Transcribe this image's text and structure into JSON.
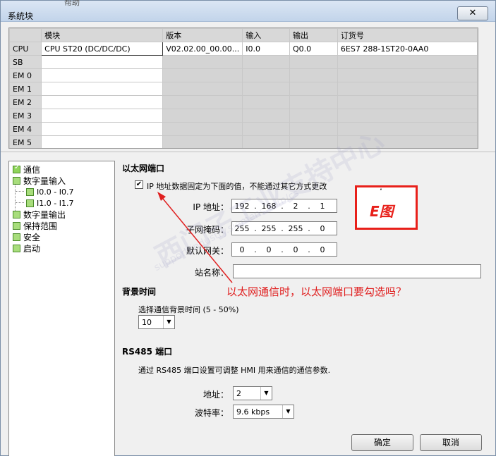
{
  "window": {
    "title": "系统块",
    "behind_menu_text": "帮助",
    "close_label": "✕"
  },
  "module_table": {
    "headers": [
      "",
      "模块",
      "版本",
      "输入",
      "输出",
      "订货号"
    ],
    "rows": [
      {
        "name": "CPU",
        "module": "CPU ST20 (DC/DC/DC)",
        "version": "V02.02.00_00.00...",
        "input": "I0.0",
        "output": "Q0.0",
        "order": "6ES7 288-1ST20-0AA0"
      },
      {
        "name": "SB",
        "module": "",
        "version": "",
        "input": "",
        "output": "",
        "order": ""
      },
      {
        "name": "EM 0",
        "module": "",
        "version": "",
        "input": "",
        "output": "",
        "order": ""
      },
      {
        "name": "EM 1",
        "module": "",
        "version": "",
        "input": "",
        "output": "",
        "order": ""
      },
      {
        "name": "EM 2",
        "module": "",
        "version": "",
        "input": "",
        "output": "",
        "order": ""
      },
      {
        "name": "EM 3",
        "module": "",
        "version": "",
        "input": "",
        "output": "",
        "order": ""
      },
      {
        "name": "EM 4",
        "module": "",
        "version": "",
        "input": "",
        "output": "",
        "order": ""
      },
      {
        "name": "EM 5",
        "module": "",
        "version": "",
        "input": "",
        "output": "",
        "order": ""
      }
    ]
  },
  "tree": {
    "items": [
      {
        "label": "通信"
      },
      {
        "label": "数字量输入"
      },
      {
        "label": "I0.0 - I0.7"
      },
      {
        "label": "I1.0 - I1.7"
      },
      {
        "label": "数字量输出"
      },
      {
        "label": "保持范围"
      },
      {
        "label": "安全"
      },
      {
        "label": "启动"
      }
    ]
  },
  "ethernet": {
    "heading": "以太网端口",
    "fixed_ip_label": "IP 地址数据固定为下面的值，不能通过其它方式更改",
    "fixed_ip_checked": true,
    "ip_label": "IP 地址：",
    "ip": [
      "192",
      "168",
      "2",
      "1"
    ],
    "mask_label": "子网掩码：",
    "mask": [
      "255",
      "255",
      "255",
      "0"
    ],
    "gateway_label": "默认网关：",
    "gateway": [
      "0",
      "0",
      "0",
      "0"
    ],
    "station_label": "站名称：",
    "station_value": ""
  },
  "background": {
    "heading": "背景时间",
    "select_label": "选择通信背景时间 (5 - 50%)",
    "value": "10"
  },
  "rs485": {
    "heading": "RS485 端口",
    "description": "通过 RS485 端口设置可调整 HMI 用来通信的通信参数.",
    "address_label": "地址：",
    "address_value": "2",
    "baud_label": "波特率：",
    "baud_value": "9.6 kbps"
  },
  "buttons": {
    "ok": "确定",
    "cancel": "取消"
  },
  "annotation": {
    "question": "以太网通信时，以太网端口要勾选吗？",
    "box_label": "E图",
    "box_tick": "·"
  },
  "watermark": {
    "main": "西门子工业支持中心",
    "sub": "support.industry.siemens.com/cs"
  },
  "colors": {
    "annotation_red": "#e02020",
    "tree_check_green": "#8fd45a"
  }
}
